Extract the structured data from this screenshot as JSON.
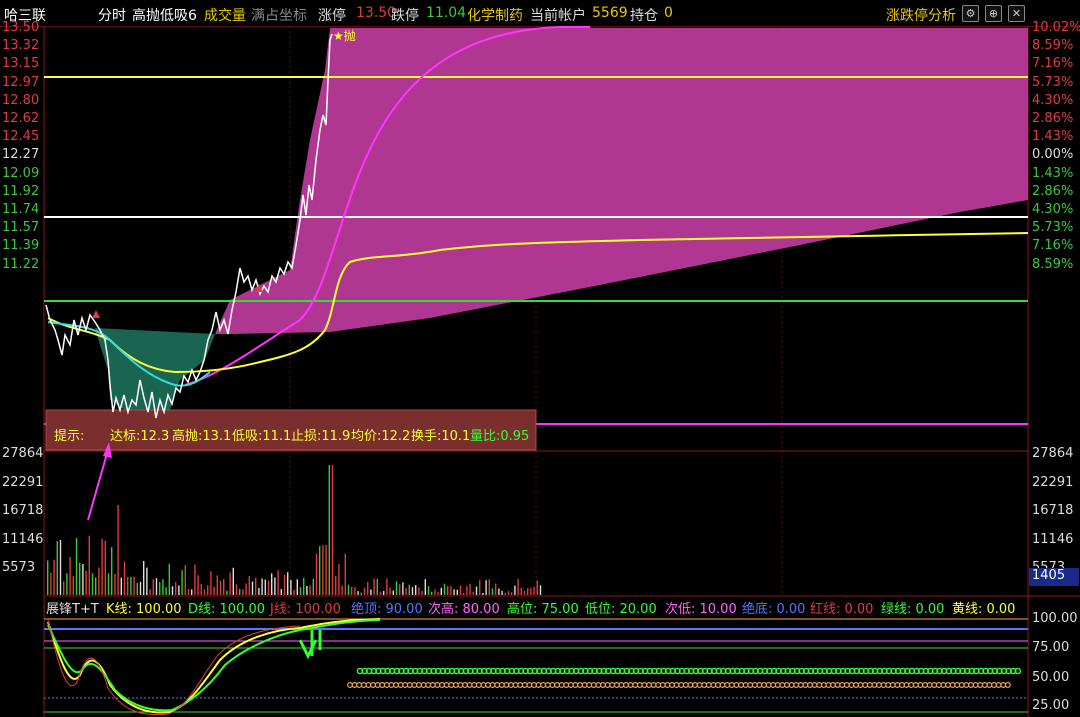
{
  "header": {
    "stock_name": "哈三联",
    "mode": "分时",
    "indicator": "高抛低吸6",
    "volume_label": "成交量",
    "full_axis_label": "满占坐标",
    "limit_up_label": "涨停",
    "limit_up_value": "13.50",
    "limit_down_label": "跌停",
    "limit_down_value": "11.04",
    "sector": "化学制药",
    "account_label": "当前帐户",
    "account_value": "5569",
    "position_label": "持仓",
    "position_value": "0",
    "analysis_label": "涨跌停分析"
  },
  "price_axis": {
    "left": [
      "13.50",
      "13.32",
      "13.15",
      "12.97",
      "12.80",
      "12.62",
      "12.45",
      "12.27",
      "12.09",
      "11.92",
      "11.74",
      "11.57",
      "11.39",
      "11.22"
    ],
    "right": [
      "10.02%",
      "8.59%",
      "7.16%",
      "5.73%",
      "4.30%",
      "2.86%",
      "1.43%",
      "0.00%",
      "1.43%",
      "2.86%",
      "4.30%",
      "5.73%",
      "7.16%",
      "8.59%"
    ]
  },
  "volume_axis": {
    "left": [
      "27864",
      "22291",
      "16718",
      "11146",
      "5573"
    ],
    "right": [
      "27864",
      "22291",
      "16718",
      "11146",
      "5573"
    ],
    "current": "1405"
  },
  "sell_marker": "★抛",
  "hint": {
    "label": "提示:",
    "target": "达标:12.3",
    "high_sell": "高抛:13.1",
    "low_buy": "低吸:11.1",
    "stop_loss": "止损:11.9",
    "avg_price": "均价:12.2",
    "turnover": "换手:10.1",
    "ratio": "量比:0.95"
  },
  "kdj": {
    "title": "展锋T+T",
    "k": "K线: 100.00",
    "d": "D线: 100.00",
    "j": "J线: 100.00",
    "top": "绝顶: 90.00",
    "sub_high": "次高: 80.00",
    "high": "高位: 75.00",
    "low": "低位: 20.00",
    "sub_low": "次低: 10.00",
    "bottom": "绝底: 0.00",
    "red_line": "红线: 0.00",
    "green_line": "绿线: 0.00",
    "yellow_line": "黄线: 0.00"
  },
  "kdj_axis": [
    "100.00",
    "75.00",
    "50.00",
    "25.00"
  ],
  "colors": {
    "up": "#e03c3c",
    "down": "#3cc83c",
    "magenta": "#ff33ff",
    "fill": "#c040a0",
    "yellow": "#ffff33",
    "cyan": "#33dddd"
  }
}
